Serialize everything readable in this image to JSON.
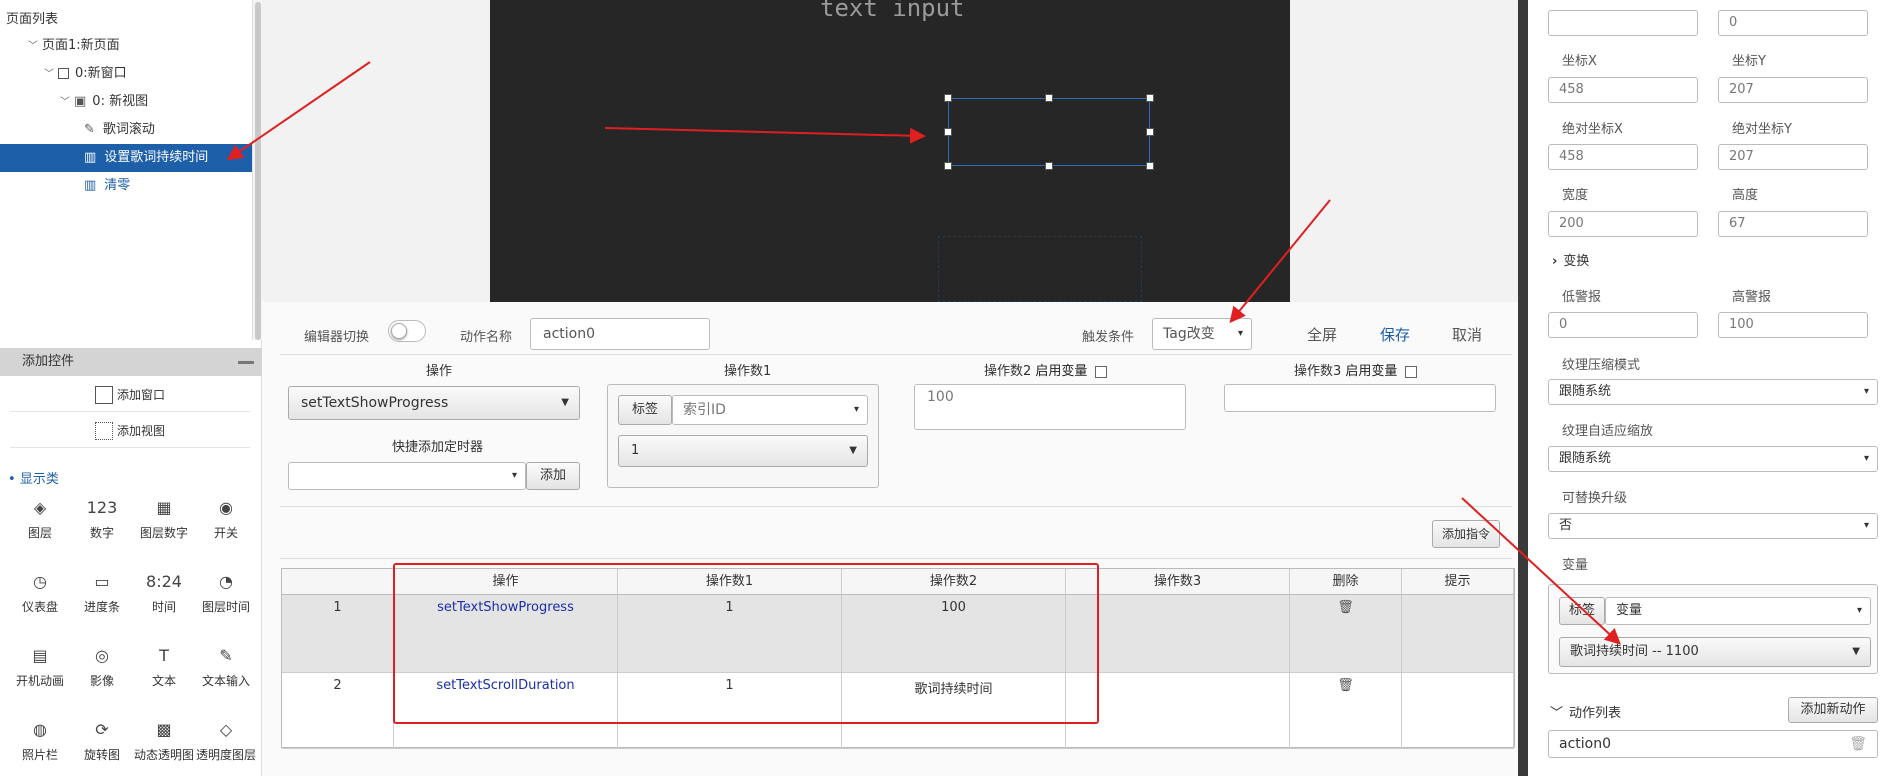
{
  "left_panel": {
    "tree_title": "页面列表",
    "tree_items": [
      {
        "label": "页面1:新页面",
        "indent": 0
      },
      {
        "label": "0:新窗口",
        "indent": 1
      },
      {
        "label": "0: 新视图",
        "indent": 2
      },
      {
        "label": "歌词滚动",
        "indent": 3
      },
      {
        "label": "设置歌词持续时间",
        "indent": 3,
        "selected": true
      },
      {
        "label": "清零",
        "indent": 3
      }
    ],
    "controls_title": "添加控件",
    "add_window": "添加窗口",
    "add_view": "添加视图",
    "category": "显示类",
    "controls": [
      {
        "label": "图层",
        "glyph": "◈"
      },
      {
        "label": "数字",
        "glyph": "123"
      },
      {
        "label": "图层数字",
        "glyph": "▦"
      },
      {
        "label": "开关",
        "glyph": "◉"
      },
      {
        "label": "仪表盘",
        "glyph": "◷"
      },
      {
        "label": "进度条",
        "glyph": "▭"
      },
      {
        "label": "时间",
        "glyph": "8:24"
      },
      {
        "label": "图层时间",
        "glyph": "◔"
      },
      {
        "label": "开机动画",
        "glyph": "▤"
      },
      {
        "label": "影像",
        "glyph": "◎"
      },
      {
        "label": "文本",
        "glyph": "T"
      },
      {
        "label": "文本输入",
        "glyph": "✎"
      },
      {
        "label": "照片栏",
        "glyph": "◍"
      },
      {
        "label": "旋转图",
        "glyph": "⟳"
      },
      {
        "label": "动态透明图",
        "glyph": "▩"
      },
      {
        "label": "透明度图层",
        "glyph": "◇"
      }
    ]
  },
  "canvas": {
    "text": "text input"
  },
  "editor": {
    "editor_toggle_label": "编辑器切换",
    "action_name_label": "动作名称",
    "action_name_value": "action0",
    "trigger_label": "触发条件",
    "trigger_value": "Tag改变",
    "fullscreen": "全屏",
    "save": "保存",
    "cancel": "取消",
    "op_header": "操作",
    "op_value": "setTextShowProgress",
    "quick_timer_label": "快捷添加定时器",
    "add_label": "添加",
    "operand1_header": "操作数1",
    "operand1_tag_label": "标签",
    "operand1_select": "索引ID",
    "operand1_value": "1",
    "operand2_header": "操作数2",
    "operand2_var_label": "启用变量",
    "operand2_value": "100",
    "operand3_header": "操作数3",
    "operand3_var_label": "启用变量",
    "add_command": "添加指令",
    "table": {
      "headers": [
        "",
        "操作",
        "操作数1",
        "操作数2",
        "操作数3",
        "删除",
        "提示"
      ],
      "rows": [
        {
          "index": "1",
          "op": "setTextShowProgress",
          "operand1": "1",
          "operand2": "100",
          "operand3": "",
          "hint": ""
        },
        {
          "index": "2",
          "op": "setTextScrollDuration",
          "operand1": "1",
          "operand2": "歌词持续时间",
          "operand3": "",
          "hint": ""
        }
      ]
    }
  },
  "right_panel": {
    "top_fields": [
      "",
      "0"
    ],
    "x_label": "坐标X",
    "y_label": "坐标Y",
    "x_value": "458",
    "y_value": "207",
    "abs_x_label": "绝对坐标X",
    "abs_y_label": "绝对坐标Y",
    "abs_x_value": "458",
    "abs_y_value": "207",
    "width_label": "宽度",
    "height_label": "高度",
    "width_value": "200",
    "height_value": "67",
    "transform_label": "变换",
    "low_alarm_label": "低警报",
    "high_alarm_label": "高警报",
    "low_alarm_value": "0",
    "high_alarm_value": "100",
    "texture_compress_label": "纹理压缩模式",
    "texture_compress_value": "跟随系统",
    "texture_scale_label": "纹理自适应缩放",
    "texture_scale_value": "跟随系统",
    "replace_upgrade_label": "可替换升级",
    "replace_upgrade_value": "否",
    "variable_label": "变量",
    "variable_tag_label": "标签",
    "variable_select": "变量",
    "variable_value": "歌词持续时间 -- 1100",
    "action_list_label": "动作列表",
    "add_action": "添加新动作",
    "action_item": "action0"
  },
  "colors": {
    "accent": "#1d5fa8",
    "annotation": "#e02020",
    "canvas_bg": "#262626"
  }
}
